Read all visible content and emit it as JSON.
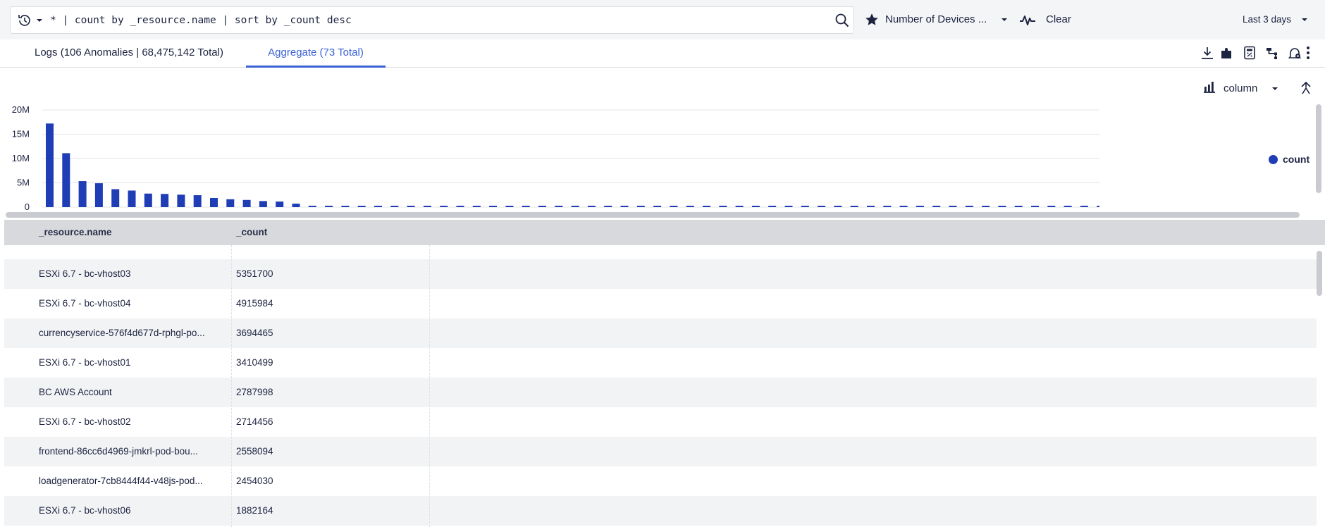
{
  "query": {
    "text": "* | count by _resource.name | sort by _count desc"
  },
  "saved_search": {
    "label": "Number of Devices ..."
  },
  "toolbar": {
    "clear_label": "Clear",
    "time_range": "Last 3 days"
  },
  "tabs": [
    {
      "label": "Logs (106 Anomalies | 68,475,142 Total)",
      "active": false
    },
    {
      "label": "Aggregate (73 Total)",
      "active": true
    }
  ],
  "chart_controls": {
    "type_label": "column"
  },
  "colors": {
    "accent": "#3a62d6",
    "series": "#1f3db5"
  },
  "icons": {
    "history": "history-icon",
    "search": "search-icon",
    "saved": "star-icon",
    "anomaly": "anomaly-detection-icon",
    "download": "download-icon",
    "plugin": "puzzle-icon",
    "calculator": "calculator-icon",
    "flow": "flow-icon",
    "alert": "alert-settings-icon",
    "more": "more-vertical-icon",
    "chart_type": "column-chart-icon",
    "collapse": "collapse-icon"
  },
  "chart_data": {
    "type": "bar",
    "y_ticks": [
      "20M",
      "15M",
      "10M",
      "5M",
      "0"
    ],
    "ylim": [
      0,
      20000000
    ],
    "grid": true,
    "legend_position": "right",
    "series": [
      {
        "name": "count",
        "values": [
          17200000,
          11100000,
          5351700,
          4915984,
          3694465,
          3410499,
          2787998,
          2714456,
          2558094,
          2454030,
          1882164,
          1620000,
          1480000,
          1250000,
          1150000,
          720000,
          120000,
          100000,
          100000,
          90000,
          90000,
          90000,
          80000,
          80000,
          80000,
          80000,
          70000,
          70000,
          70000,
          70000,
          60000,
          60000,
          60000,
          60000,
          60000,
          50000,
          50000,
          50000,
          50000,
          50000,
          50000,
          40000,
          40000,
          40000,
          40000,
          40000,
          40000,
          40000,
          30000,
          30000,
          30000,
          30000,
          30000,
          30000,
          30000,
          30000,
          30000,
          30000,
          30000,
          30000,
          30000,
          30000,
          30000,
          30000,
          30000,
          30000,
          30000,
          30000,
          30000,
          30000,
          30000,
          30000,
          30000,
          30000
        ]
      }
    ]
  },
  "table": {
    "columns": [
      "_resource.name",
      "_count"
    ],
    "rows": [
      {
        "name": "",
        "count": ""
      },
      {
        "name": "ESXi 6.7 - bc-vhost03",
        "count": "5351700"
      },
      {
        "name": "ESXi 6.7 - bc-vhost04",
        "count": "4915984"
      },
      {
        "name": "currencyservice-576f4d677d-rphgl-po...",
        "count": "3694465"
      },
      {
        "name": "ESXi 6.7 - bc-vhost01",
        "count": "3410499"
      },
      {
        "name": "BC AWS Account",
        "count": "2787998"
      },
      {
        "name": "ESXi 6.7 - bc-vhost02",
        "count": "2714456"
      },
      {
        "name": "frontend-86cc6d4969-jmkrl-pod-bou...",
        "count": "2558094"
      },
      {
        "name": "loadgenerator-7cb8444f44-v48js-pod...",
        "count": "2454030"
      },
      {
        "name": "ESXi 6.7 - bc-vhost06",
        "count": "1882164"
      }
    ]
  }
}
